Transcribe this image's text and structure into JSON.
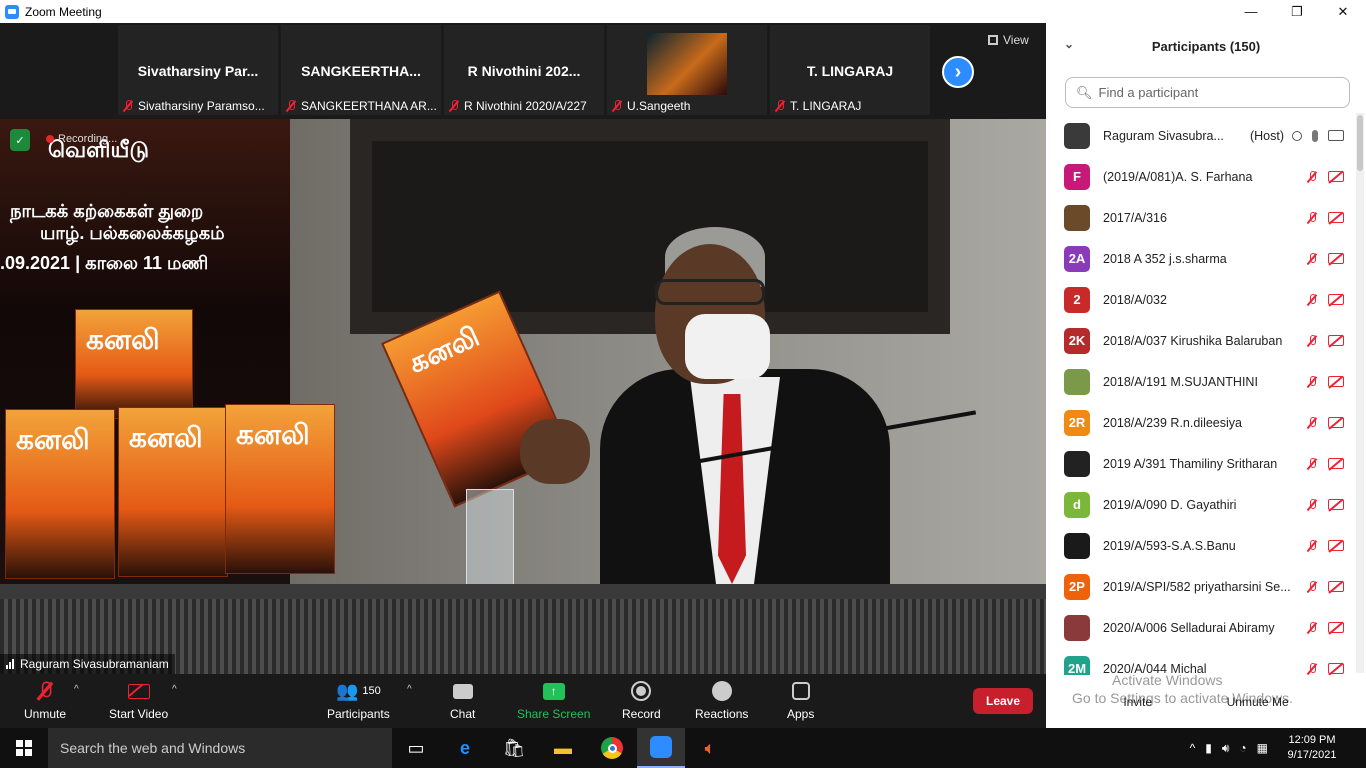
{
  "window": {
    "title": "Zoom Meeting",
    "minimize": "—",
    "maximize": "❐",
    "close": "✕"
  },
  "strip": {
    "thumbnails": [
      {
        "name": "Sivatharsiny  Par...",
        "label": "Sivatharsiny Paramso..."
      },
      {
        "name": "SANGKEERTHA...",
        "label": "SANGKEERTHANA AR..."
      },
      {
        "name": "R Nivothini 202...",
        "label": "R Nivothini 2020/A/227"
      },
      {
        "name": "",
        "label": "U.Sangeeth"
      },
      {
        "name": "T. LINGARAJ",
        "label": "T. LINGARAJ"
      }
    ],
    "view_label": "View",
    "next_arrow": "›"
  },
  "speaker": {
    "name": "Raguram Sivasubramaniam",
    "recording_label": "Recording...",
    "banner_lines": [
      "வெளியீடு",
      "நாடகக் கற்கைகள் துறை",
      "யாழ். பல்கலைக்கழகம்",
      ".09.2021 | காலை 11 மணி"
    ],
    "book_title": "கனலி"
  },
  "toolbar": {
    "unmute": "Unmute",
    "start_video": "Start Video",
    "participants": "Participants",
    "participants_count": "150",
    "chat": "Chat",
    "share_screen": "Share Screen",
    "record": "Record",
    "reactions": "Reactions",
    "apps": "Apps",
    "leave": "Leave",
    "caret": "^"
  },
  "panel": {
    "title": "Participants (150)",
    "search_placeholder": "Find a participant",
    "participants": [
      {
        "avatar": "",
        "avatar_color": "#3a3a3a",
        "name": "Raguram Sivasubra...",
        "host": "(Host)",
        "muted": false
      },
      {
        "avatar": "F",
        "avatar_color": "#c7197a",
        "name": "(2019/A/081)A. S. Farhana",
        "muted": true
      },
      {
        "avatar": "",
        "avatar_color": "#6b4a2a",
        "name": "2017/A/316",
        "muted": true
      },
      {
        "avatar": "2A",
        "avatar_color": "#8a3bb8",
        "name": "2018 A 352 j.s.sharma",
        "muted": true
      },
      {
        "avatar": "2",
        "avatar_color": "#c82a2a",
        "name": "2018/A/032",
        "muted": true
      },
      {
        "avatar": "2K",
        "avatar_color": "#b52a2a",
        "name": "2018/A/037 Kirushika Balaruban",
        "muted": true
      },
      {
        "avatar": "",
        "avatar_color": "#7a9a4a",
        "name": "2018/A/191 M.SUJANTHINI",
        "muted": true
      },
      {
        "avatar": "2R",
        "avatar_color": "#f08a12",
        "name": "2018/A/239 R.n.dileesiya",
        "muted": true
      },
      {
        "avatar": "",
        "avatar_color": "#222222",
        "name": "2019 A/391 Thamiliny Sritharan",
        "muted": true
      },
      {
        "avatar": "d",
        "avatar_color": "#7bb83a",
        "name": "2019/A/090 D. Gayathiri",
        "muted": true
      },
      {
        "avatar": "",
        "avatar_color": "#1a1a1a",
        "name": "2019/A/593-S.A.S.Banu",
        "muted": true
      },
      {
        "avatar": "2P",
        "avatar_color": "#f0620a",
        "name": "2019/A/SPI/582  priyatharsini Se...",
        "muted": true
      },
      {
        "avatar": "",
        "avatar_color": "#8a3a3a",
        "name": "2020/A/006 Selladurai Abiramy",
        "muted": true
      },
      {
        "avatar": "2M",
        "avatar_color": "#1fa38a",
        "name": "2020/A/044 Michal",
        "muted": true
      }
    ],
    "watermark_1": "Activate Windows",
    "watermark_2": "Go to Settings to activate Windows.",
    "invite": "Invite",
    "unmute_me": "Unmute Me"
  },
  "taskbar": {
    "search_placeholder": "Search the web and Windows",
    "time": "12:09 PM",
    "date": "9/17/2021"
  }
}
